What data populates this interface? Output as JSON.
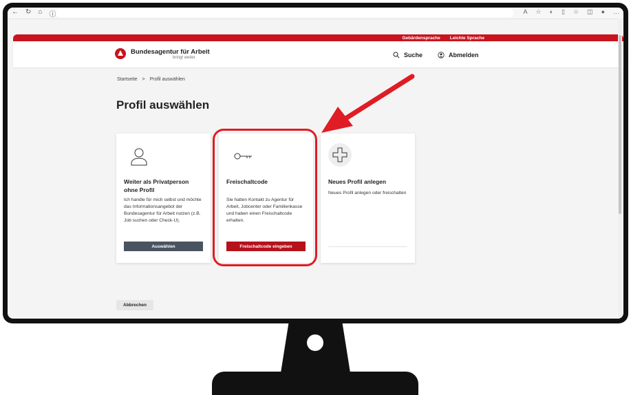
{
  "header": {
    "top_links": [
      "Gebärdensprache",
      "Leichte Sprache"
    ],
    "brand": "Bundesagentur für Arbeit",
    "tagline": "bringt weiter.",
    "search_label": "Suche",
    "logout_label": "Abmelden"
  },
  "breadcrumb": [
    "Startseite",
    ">",
    "Profil auswählen"
  ],
  "page_title": "Profil auswählen",
  "cards": [
    {
      "title": "Weiter als Privatperson ohne Profil",
      "text": "Ich handle für mich selbst und möchte das Informationsangebot der Bundesagentur für Arbeit nutzen (z.B. Job suchen oder Check-U).",
      "button": "Auswählen",
      "icon": "person-icon"
    },
    {
      "title": "Freischaltcode",
      "text": "Sie hatten Kontakt zu Agentur für Arbeit, Jobcenter oder Familienkasse und haben einen Freischaltcode erhalten.",
      "button": "Freischaltcode eingeben",
      "icon": "key-icon"
    },
    {
      "title": "Neues Profil anlegen",
      "text": "Neues Profil anlegen oder freischalten",
      "icon": "plus-icon"
    }
  ],
  "cancel_label": "Abbrechen",
  "colors": {
    "brand_red": "#c8141e",
    "highlight_red": "#e01c24",
    "button_gray": "#4a5360",
    "button_red": "#b5121b"
  }
}
